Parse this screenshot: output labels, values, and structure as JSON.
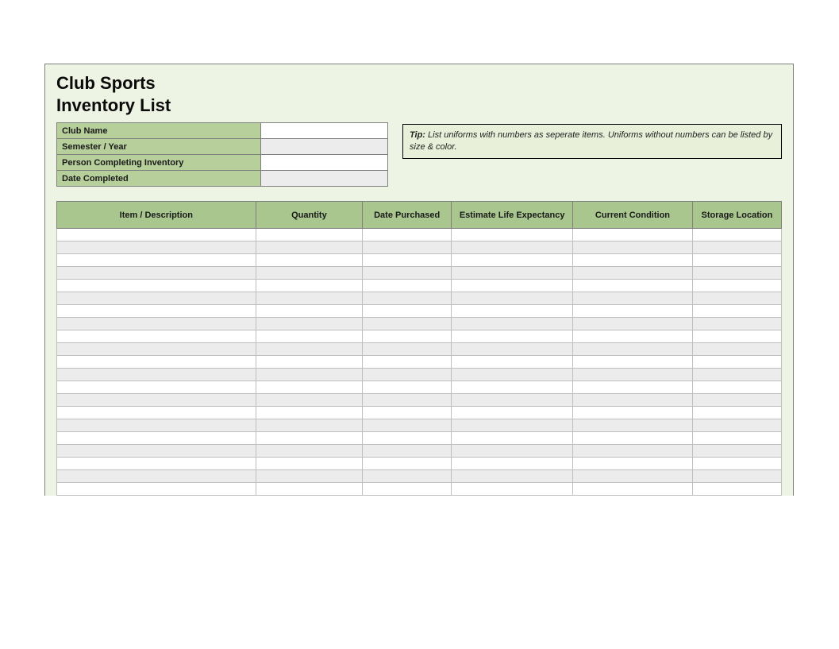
{
  "title": {
    "line1": "Club Sports",
    "line2": "Inventory List"
  },
  "meta": {
    "fields": [
      {
        "label": "Club Name",
        "value": ""
      },
      {
        "label": "Semester / Year",
        "value": ""
      },
      {
        "label": "Person Completing Inventory",
        "value": ""
      },
      {
        "label": "Date Completed",
        "value": ""
      }
    ]
  },
  "tip": {
    "label": "Tip:",
    "text": " List uniforms with numbers as seperate items. Uniforms without numbers can be listed by size & color."
  },
  "inventory": {
    "headers": [
      "Item / Description",
      "Quantity",
      "Date Purchased",
      "Estimate Life Expectancy",
      "Current Condition",
      "Storage Location"
    ],
    "rows": [
      [
        "",
        "",
        "",
        "",
        "",
        ""
      ],
      [
        "",
        "",
        "",
        "",
        "",
        ""
      ],
      [
        "",
        "",
        "",
        "",
        "",
        ""
      ],
      [
        "",
        "",
        "",
        "",
        "",
        ""
      ],
      [
        "",
        "",
        "",
        "",
        "",
        ""
      ],
      [
        "",
        "",
        "",
        "",
        "",
        ""
      ],
      [
        "",
        "",
        "",
        "",
        "",
        ""
      ],
      [
        "",
        "",
        "",
        "",
        "",
        ""
      ],
      [
        "",
        "",
        "",
        "",
        "",
        ""
      ],
      [
        "",
        "",
        "",
        "",
        "",
        ""
      ],
      [
        "",
        "",
        "",
        "",
        "",
        ""
      ],
      [
        "",
        "",
        "",
        "",
        "",
        ""
      ],
      [
        "",
        "",
        "",
        "",
        "",
        ""
      ],
      [
        "",
        "",
        "",
        "",
        "",
        ""
      ],
      [
        "",
        "",
        "",
        "",
        "",
        ""
      ],
      [
        "",
        "",
        "",
        "",
        "",
        ""
      ],
      [
        "",
        "",
        "",
        "",
        "",
        ""
      ],
      [
        "",
        "",
        "",
        "",
        "",
        ""
      ],
      [
        "",
        "",
        "",
        "",
        "",
        ""
      ],
      [
        "",
        "",
        "",
        "",
        "",
        ""
      ],
      [
        "",
        "",
        "",
        "",
        "",
        ""
      ]
    ]
  }
}
